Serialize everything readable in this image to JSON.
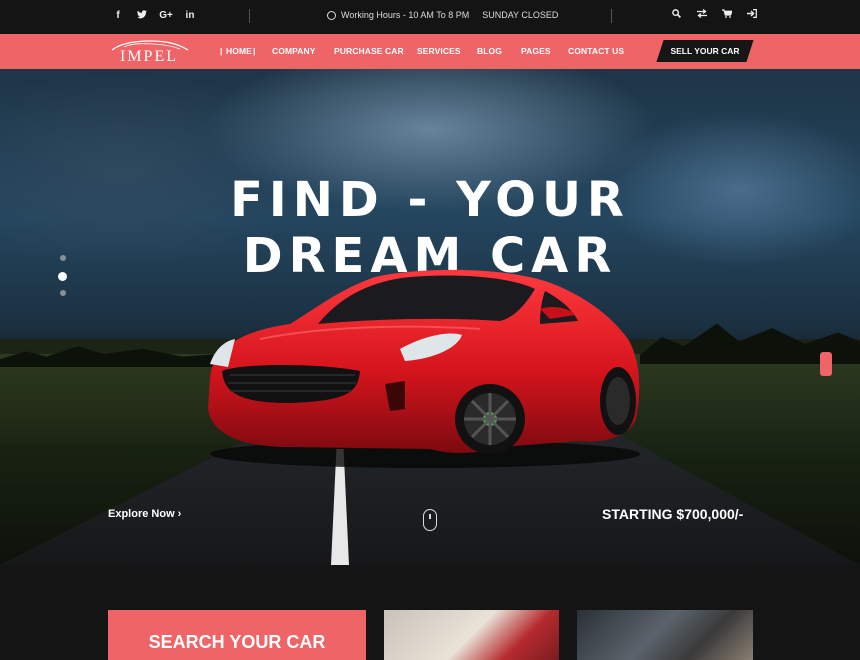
{
  "topbar": {
    "social": [
      "f",
      "t",
      "G+",
      "in"
    ],
    "hours": "Working Hours - 10 AM To 8 PM",
    "closed": "SUNDAY CLOSED",
    "icons": [
      "search-icon",
      "compare-icon",
      "cart-icon",
      "login-icon"
    ]
  },
  "brand": {
    "name": "IMPEL"
  },
  "nav": {
    "items": [
      "HOME",
      "COMPANY",
      "PURCHASE CAR",
      "SERVICES",
      "BLOG",
      "PAGES",
      "CONTACT US"
    ],
    "cta": "SELL YOUR CAR"
  },
  "hero": {
    "headline_1": "FIND - YOUR",
    "headline_2": "DREAM CAR",
    "explore": "Explore Now ›",
    "price": "STARTING $700,000/-",
    "slides_total": 3,
    "slide_active": 2
  },
  "bottom": {
    "search_title": "SEARCH YOUR CAR"
  },
  "colors": {
    "accent": "#ee6467",
    "dark": "#141414"
  }
}
